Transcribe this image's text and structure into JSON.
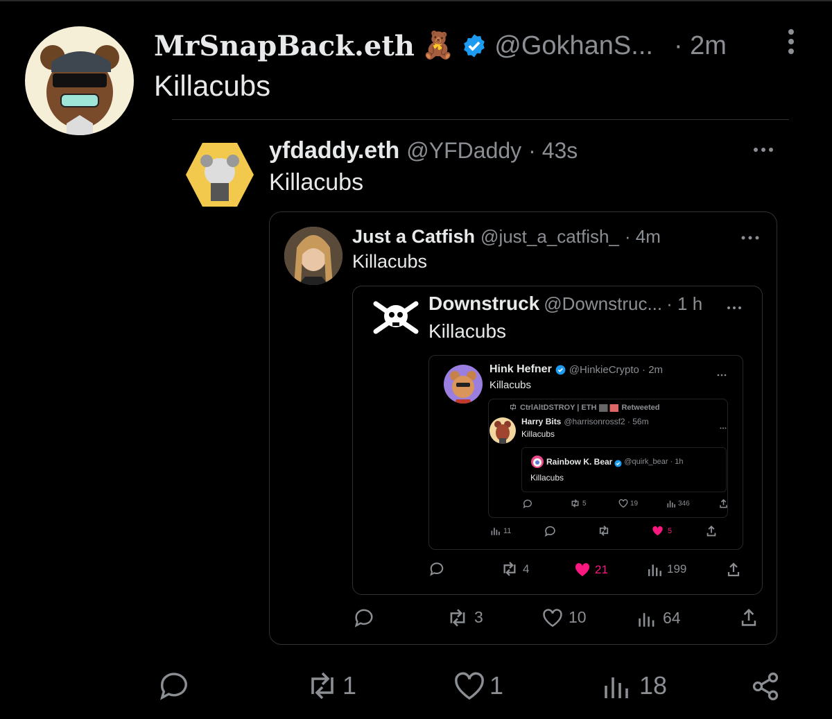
{
  "main": {
    "name": "MrSnapBack.eth",
    "emoji": "🧸",
    "handle": "@GokhanS...",
    "time": "· 2m",
    "text": "Killacubs",
    "actions": {
      "replies": "",
      "retweets": "1",
      "likes": "1",
      "views": "18"
    }
  },
  "q1": {
    "name": "yfdaddy.eth",
    "handle": "@YFDaddy",
    "time": "· 43s",
    "text": "Killacubs"
  },
  "q2": {
    "name": "Just a Catfish",
    "handle": "@just_a_catfish_",
    "time": "· 4m",
    "text": "Killacubs",
    "actions": {
      "retweets": "3",
      "likes": "10",
      "views": "64"
    }
  },
  "q3": {
    "name": "Downstruck",
    "handle": "@Downstruc...",
    "time": "· 1 h",
    "text": "Killacubs",
    "actions": {
      "retweets": "4",
      "likes": "21",
      "views": "199"
    }
  },
  "q4": {
    "name": "Hink Hefner",
    "handle": "@HinkieCrypto · 2m",
    "text": "Killacubs",
    "actions": {
      "views": "11",
      "likes": "5"
    }
  },
  "q5": {
    "retweet_note": "CtrlAltDSTROY | ETH",
    "retweeted": "Retweeted",
    "name": "Harry Bits",
    "handle": "@harrisonrossf2 · 56m",
    "text": "Killacubs",
    "actions": {
      "retweets": "5",
      "likes": "19",
      "views": "346"
    }
  },
  "q6": {
    "name": "Rainbow K. Bear",
    "handle": "@quirk_bear · 1h",
    "text": "Killacubs"
  },
  "colors": {
    "background": "#000000",
    "verified": "#1d9bf0",
    "like": "#f91880",
    "muted": "#8b8f94"
  }
}
